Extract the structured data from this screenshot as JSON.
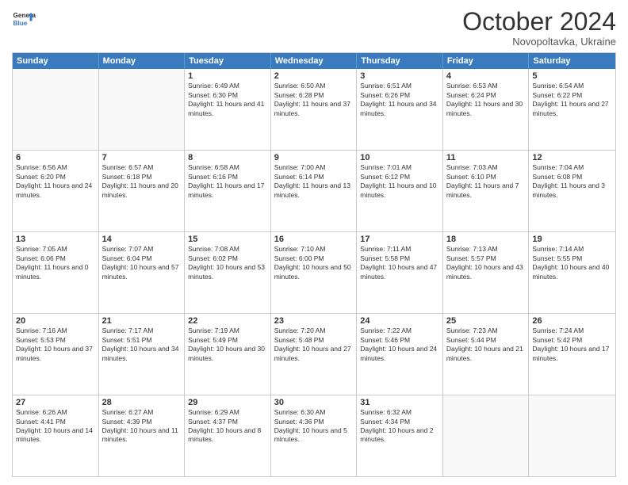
{
  "header": {
    "logo_line1": "General",
    "logo_line2": "Blue",
    "month_title": "October 2024",
    "subtitle": "Novopoltavka, Ukraine"
  },
  "days_of_week": [
    "Sunday",
    "Monday",
    "Tuesday",
    "Wednesday",
    "Thursday",
    "Friday",
    "Saturday"
  ],
  "weeks": [
    [
      {
        "day": "",
        "info": ""
      },
      {
        "day": "",
        "info": ""
      },
      {
        "day": "1",
        "info": "Sunrise: 6:49 AM\nSunset: 6:30 PM\nDaylight: 11 hours and 41 minutes."
      },
      {
        "day": "2",
        "info": "Sunrise: 6:50 AM\nSunset: 6:28 PM\nDaylight: 11 hours and 37 minutes."
      },
      {
        "day": "3",
        "info": "Sunrise: 6:51 AM\nSunset: 6:26 PM\nDaylight: 11 hours and 34 minutes."
      },
      {
        "day": "4",
        "info": "Sunrise: 6:53 AM\nSunset: 6:24 PM\nDaylight: 11 hours and 30 minutes."
      },
      {
        "day": "5",
        "info": "Sunrise: 6:54 AM\nSunset: 6:22 PM\nDaylight: 11 hours and 27 minutes."
      }
    ],
    [
      {
        "day": "6",
        "info": "Sunrise: 6:56 AM\nSunset: 6:20 PM\nDaylight: 11 hours and 24 minutes."
      },
      {
        "day": "7",
        "info": "Sunrise: 6:57 AM\nSunset: 6:18 PM\nDaylight: 11 hours and 20 minutes."
      },
      {
        "day": "8",
        "info": "Sunrise: 6:58 AM\nSunset: 6:16 PM\nDaylight: 11 hours and 17 minutes."
      },
      {
        "day": "9",
        "info": "Sunrise: 7:00 AM\nSunset: 6:14 PM\nDaylight: 11 hours and 13 minutes."
      },
      {
        "day": "10",
        "info": "Sunrise: 7:01 AM\nSunset: 6:12 PM\nDaylight: 11 hours and 10 minutes."
      },
      {
        "day": "11",
        "info": "Sunrise: 7:03 AM\nSunset: 6:10 PM\nDaylight: 11 hours and 7 minutes."
      },
      {
        "day": "12",
        "info": "Sunrise: 7:04 AM\nSunset: 6:08 PM\nDaylight: 11 hours and 3 minutes."
      }
    ],
    [
      {
        "day": "13",
        "info": "Sunrise: 7:05 AM\nSunset: 6:06 PM\nDaylight: 11 hours and 0 minutes."
      },
      {
        "day": "14",
        "info": "Sunrise: 7:07 AM\nSunset: 6:04 PM\nDaylight: 10 hours and 57 minutes."
      },
      {
        "day": "15",
        "info": "Sunrise: 7:08 AM\nSunset: 6:02 PM\nDaylight: 10 hours and 53 minutes."
      },
      {
        "day": "16",
        "info": "Sunrise: 7:10 AM\nSunset: 6:00 PM\nDaylight: 10 hours and 50 minutes."
      },
      {
        "day": "17",
        "info": "Sunrise: 7:11 AM\nSunset: 5:58 PM\nDaylight: 10 hours and 47 minutes."
      },
      {
        "day": "18",
        "info": "Sunrise: 7:13 AM\nSunset: 5:57 PM\nDaylight: 10 hours and 43 minutes."
      },
      {
        "day": "19",
        "info": "Sunrise: 7:14 AM\nSunset: 5:55 PM\nDaylight: 10 hours and 40 minutes."
      }
    ],
    [
      {
        "day": "20",
        "info": "Sunrise: 7:16 AM\nSunset: 5:53 PM\nDaylight: 10 hours and 37 minutes."
      },
      {
        "day": "21",
        "info": "Sunrise: 7:17 AM\nSunset: 5:51 PM\nDaylight: 10 hours and 34 minutes."
      },
      {
        "day": "22",
        "info": "Sunrise: 7:19 AM\nSunset: 5:49 PM\nDaylight: 10 hours and 30 minutes."
      },
      {
        "day": "23",
        "info": "Sunrise: 7:20 AM\nSunset: 5:48 PM\nDaylight: 10 hours and 27 minutes."
      },
      {
        "day": "24",
        "info": "Sunrise: 7:22 AM\nSunset: 5:46 PM\nDaylight: 10 hours and 24 minutes."
      },
      {
        "day": "25",
        "info": "Sunrise: 7:23 AM\nSunset: 5:44 PM\nDaylight: 10 hours and 21 minutes."
      },
      {
        "day": "26",
        "info": "Sunrise: 7:24 AM\nSunset: 5:42 PM\nDaylight: 10 hours and 17 minutes."
      }
    ],
    [
      {
        "day": "27",
        "info": "Sunrise: 6:26 AM\nSunset: 4:41 PM\nDaylight: 10 hours and 14 minutes."
      },
      {
        "day": "28",
        "info": "Sunrise: 6:27 AM\nSunset: 4:39 PM\nDaylight: 10 hours and 11 minutes."
      },
      {
        "day": "29",
        "info": "Sunrise: 6:29 AM\nSunset: 4:37 PM\nDaylight: 10 hours and 8 minutes."
      },
      {
        "day": "30",
        "info": "Sunrise: 6:30 AM\nSunset: 4:36 PM\nDaylight: 10 hours and 5 minutes."
      },
      {
        "day": "31",
        "info": "Sunrise: 6:32 AM\nSunset: 4:34 PM\nDaylight: 10 hours and 2 minutes."
      },
      {
        "day": "",
        "info": ""
      },
      {
        "day": "",
        "info": ""
      }
    ]
  ]
}
